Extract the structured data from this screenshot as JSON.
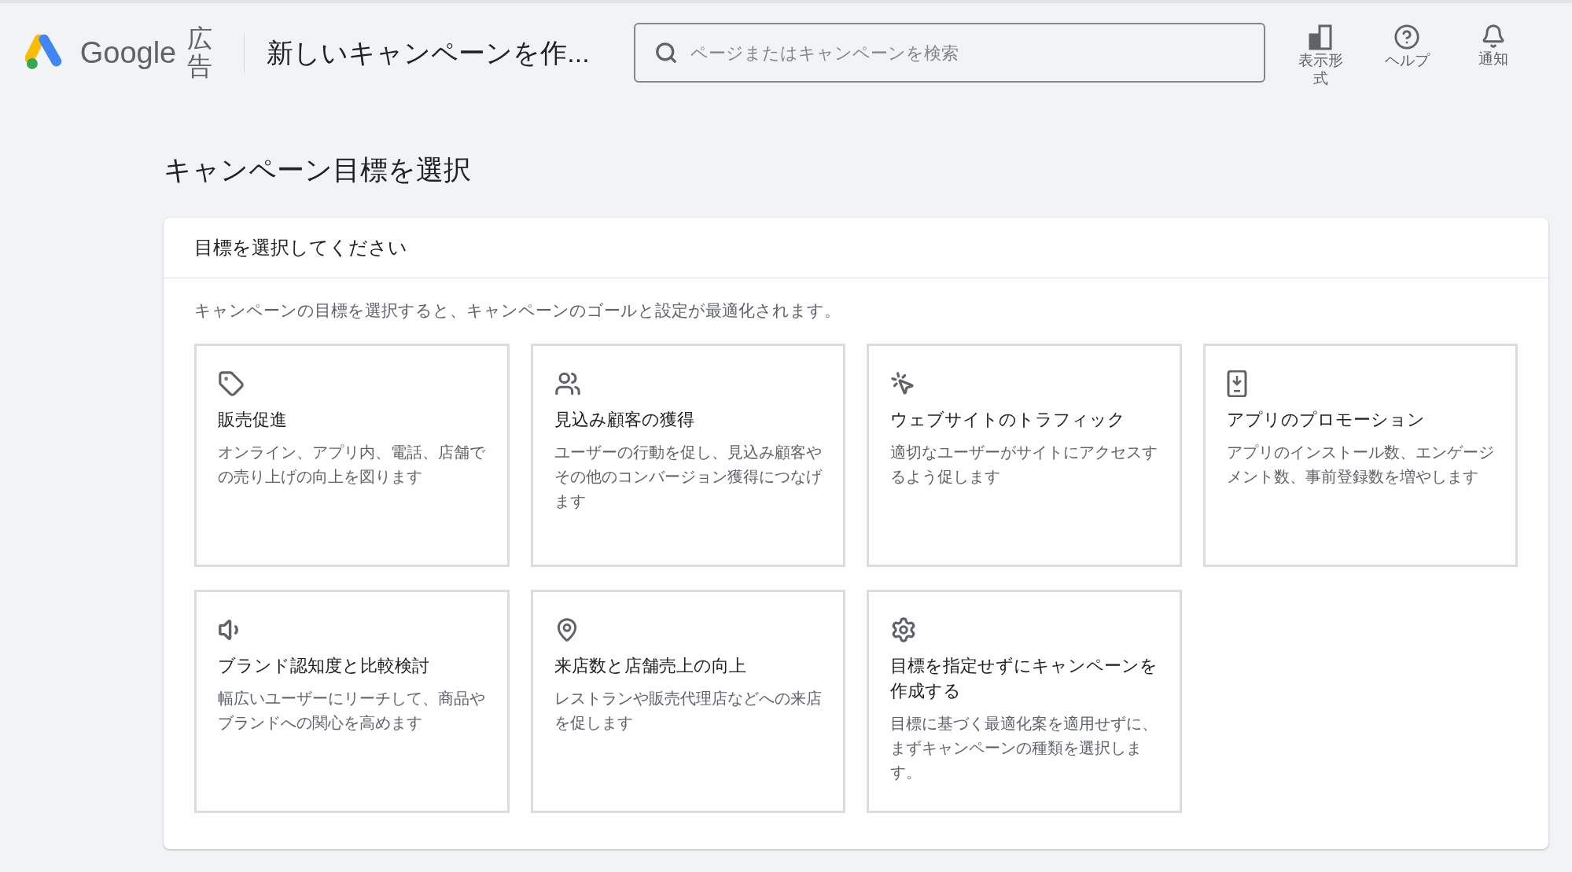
{
  "header": {
    "brand": "Google",
    "product": "広告",
    "page_title": "新しいキャンペーンを作...",
    "search": {
      "placeholder": "ページまたはキャンペーンを検索"
    },
    "actions": [
      {
        "kind": "appearance",
        "label": "表示形式"
      },
      {
        "kind": "help",
        "label": "ヘルプ"
      },
      {
        "kind": "notifications",
        "label": "通知"
      }
    ]
  },
  "heading": "キャンペーン目標を選択",
  "panel": {
    "title": "目標を選択してください",
    "description": "キャンペーンの目標を選択すると、キャンペーンのゴールと設定が最適化されます。",
    "goals": [
      {
        "kind": "sales",
        "title": "販売促進",
        "description": "オンライン、アプリ内、電話、店舗での売り上げの向上を図ります"
      },
      {
        "kind": "leads",
        "title": "見込み顧客の獲得",
        "description": "ユーザーの行動を促し、見込み顧客やその他のコンバージョン獲得につなげます"
      },
      {
        "kind": "traffic",
        "title": "ウェブサイトのトラフィック",
        "description": "適切なユーザーがサイトにアクセスするよう促します"
      },
      {
        "kind": "app",
        "title": "アプリのプロモーション",
        "description": "アプリのインストール数、エンゲージメント数、事前登録数を増やします"
      },
      {
        "kind": "awareness",
        "title": "ブランド認知度と比較検討",
        "description": "幅広いユーザーにリーチして、商品やブランドへの関心を高めます"
      },
      {
        "kind": "store",
        "title": "来店数と店舗売上の向上",
        "description": "レストランや販売代理店などへの来店を促します"
      },
      {
        "kind": "none",
        "title": "目標を指定せずにキャンペーンを作成する",
        "description": "目標に基づく最適化案を適用せずに、まずキャンペーンの種類を選択します。"
      }
    ]
  }
}
